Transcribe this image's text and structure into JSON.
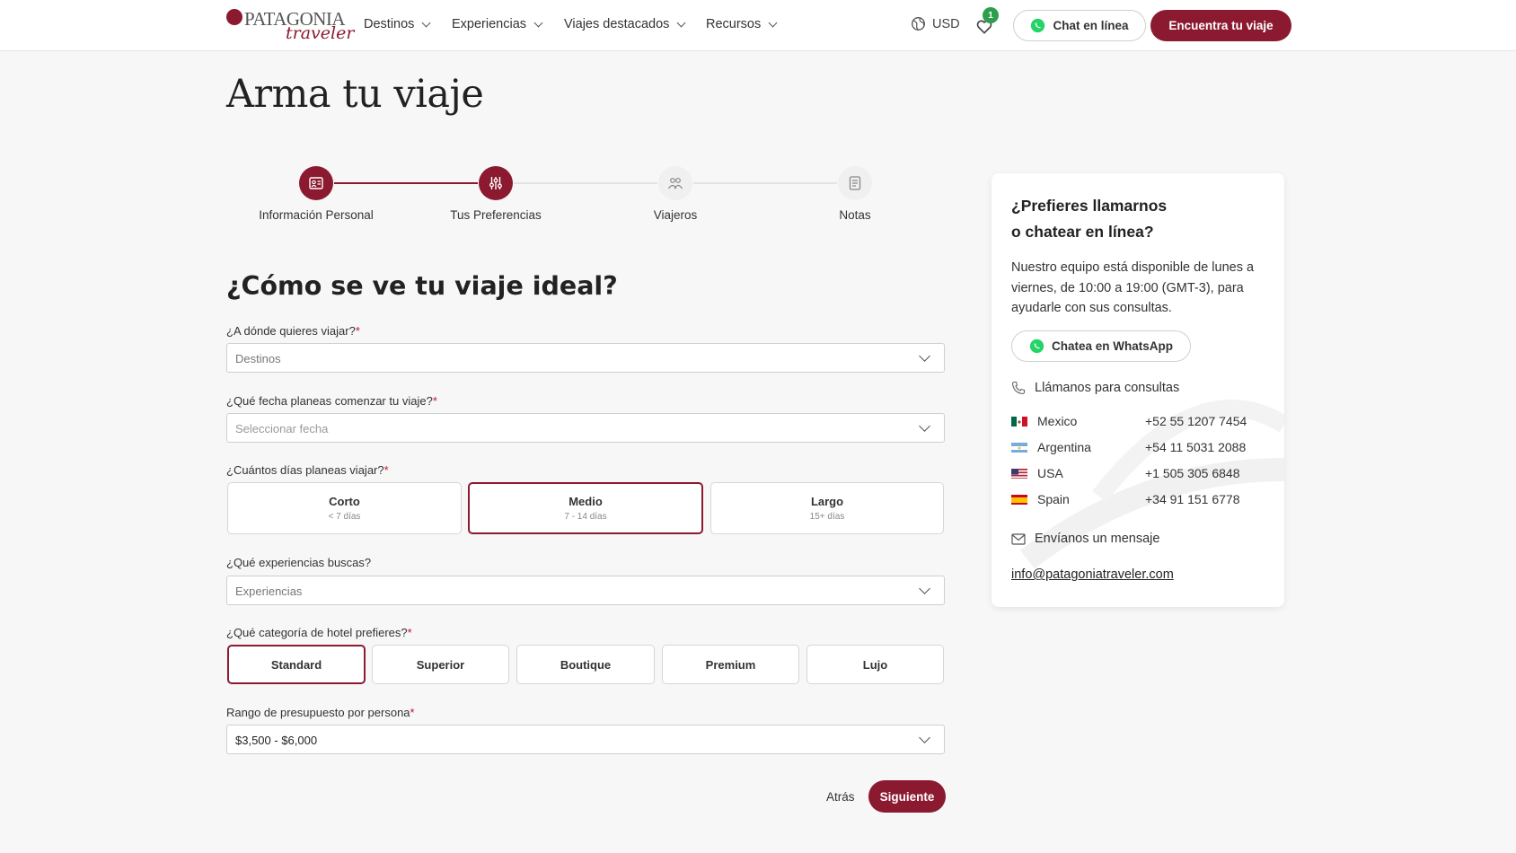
{
  "header": {
    "logo_text": "PATAGONIA",
    "logo_sub": "traveler",
    "nav": [
      "Destinos",
      "Experiencias",
      "Viajes destacados",
      "Recursos"
    ],
    "currency": "USD",
    "wishlist_count": "1",
    "chat_label": "Chat en línea",
    "find_label": "Encuentra tu viaje"
  },
  "page_title": "Arma tu viaje",
  "steps": [
    {
      "label": "Información Personal",
      "state": "done",
      "icon": "id-card-icon"
    },
    {
      "label": "Tus Preferencias",
      "state": "active",
      "icon": "sliders-icon"
    },
    {
      "label": "Viajeros",
      "state": "pending",
      "icon": "travelers-icon"
    },
    {
      "label": "Notas",
      "state": "pending",
      "icon": "notes-icon"
    }
  ],
  "form": {
    "title": "¿Cómo se ve tu viaje ideal?",
    "destination_label": "¿A dónde quieres viajar?",
    "destination_placeholder": "Destinos",
    "date_label": "¿Qué fecha planeas comenzar tu viaje?",
    "date_placeholder": "Seleccionar fecha",
    "days_label": "¿Cuántos días planeas viajar?",
    "days_options": [
      {
        "title": "Corto",
        "sub": "< 7 días"
      },
      {
        "title": "Medio",
        "sub": "7 - 14 días"
      },
      {
        "title": "Largo",
        "sub": "15+ días"
      }
    ],
    "days_selected": "Medio",
    "experiences_label": "¿Qué experiencias buscas?",
    "experiences_placeholder": "Experiencias",
    "hotel_label": "¿Qué categoría de hotel prefieres?",
    "hotel_options": [
      "Standard",
      "Superior",
      "Boutique",
      "Premium",
      "Lujo"
    ],
    "hotel_selected": "Standard",
    "budget_label": "Rango de presupuesto por persona",
    "budget_value": "$3,500 - $6,000",
    "required_mark": "*",
    "back_label": "Atrás",
    "next_label": "Siguiente"
  },
  "contact": {
    "heading_line1": "¿Prefieres llamarnos",
    "heading_line2": "o chatear en línea?",
    "text": "Nuestro equipo está disponible de lunes a viernes, de 10:00 a 19:00 (GMT-3), para ayudarle con sus consultas.",
    "whatsapp_label": "Chatea en WhatsApp",
    "call_label": "Llámanos para consultas",
    "phones": [
      {
        "country": "Mexico",
        "number": "+52 55 1207 7454"
      },
      {
        "country": "Argentina",
        "number": "+54 11 5031 2088"
      },
      {
        "country": "USA",
        "number": "+1 505 305 6848"
      },
      {
        "country": "Spain",
        "number": "+34 91 151 6778"
      }
    ],
    "message_label": "Envíanos un mensaje",
    "email": "info@patagoniatraveler.com"
  },
  "colors": {
    "brand": "#8b1a30",
    "whatsapp": "#25d366",
    "badge": "#2e9e4d"
  }
}
